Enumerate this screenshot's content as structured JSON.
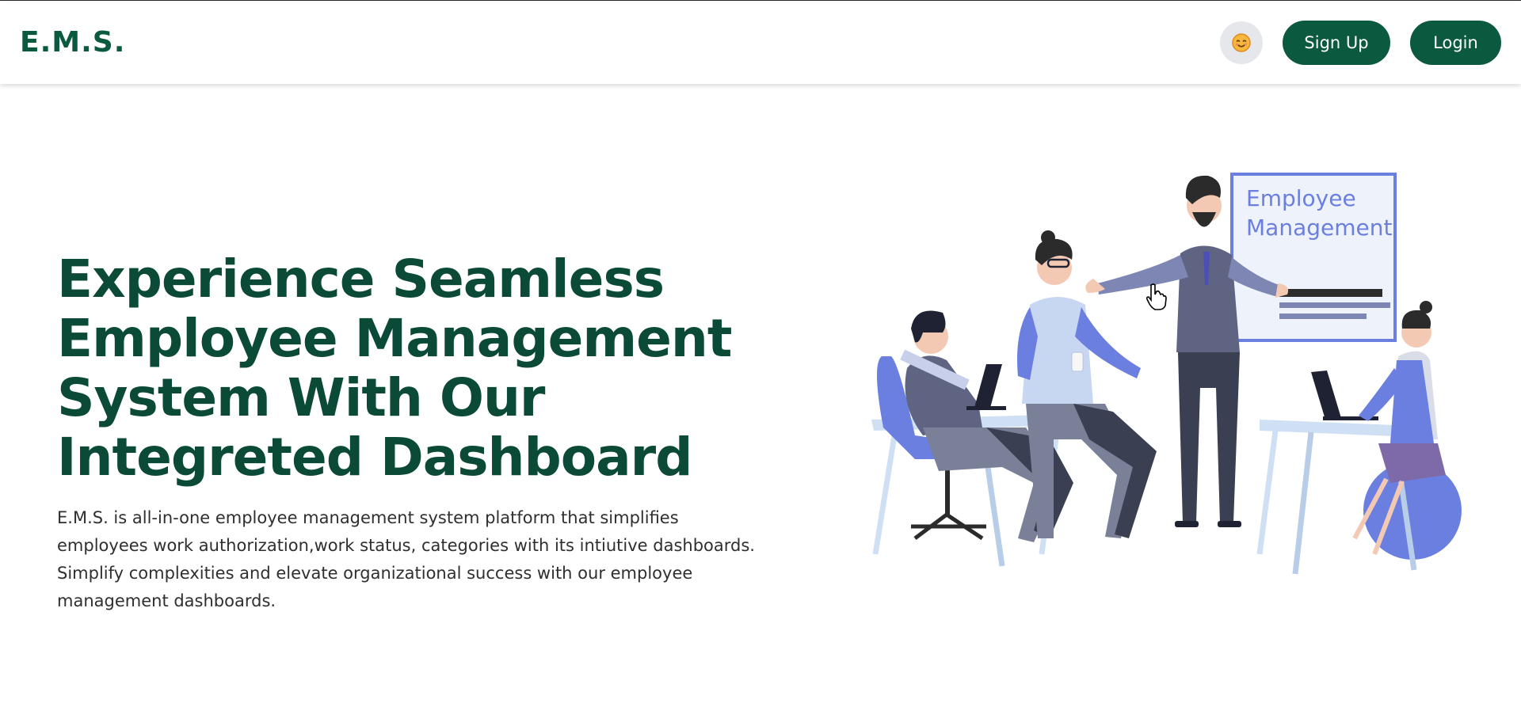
{
  "nav": {
    "brand": "E.M.S.",
    "theme_icon": "sun-face-emoji",
    "signup_label": "Sign Up",
    "login_label": "Login"
  },
  "hero": {
    "title_lines": [
      "Experience Seamless",
      "Employee Management",
      "System With Our",
      "Integreted Dashboard"
    ],
    "description_lines": [
      "E.M.S. is all-in-one employee management system platform that simplifies",
      "employees work authorization,work status, categories with its intiutive dashboards.",
      "Simplify complexities and elevate organizational success with our employee",
      "management dashboards."
    ]
  },
  "illustration": {
    "board_line1": "Employee",
    "board_line2": "Management"
  },
  "colors": {
    "brand": "#0b5a3f",
    "title": "#0b4a36",
    "accent_blue": "#6b7fe0"
  }
}
